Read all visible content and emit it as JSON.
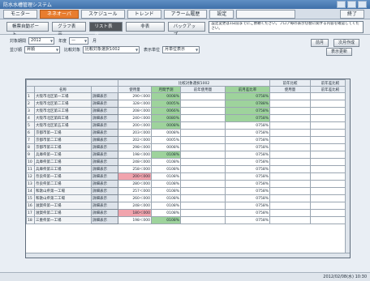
{
  "title": "防水水槽管理システム",
  "menu": {
    "items": [
      "モニター",
      "ネネオーバ",
      "スケジュール",
      "トレンド",
      "アラーム履歴",
      "設定",
      "",
      "終了"
    ],
    "active_index": 1
  },
  "toolbar": {
    "buttons": [
      "帳票自動ポート",
      "グラフ表示",
      "リスト表示",
      "非表",
      "バックアップ"
    ]
  },
  "notice": "設定変更は1日前までにご依頼ください。フロア毎の表示切替に関する内容を確認してください。",
  "filters": {
    "period_label": "対象期間",
    "period_value": "2012",
    "year_label": "年度",
    "month_value": "—",
    "month_suffix": "月",
    "unit_label": "並び順",
    "unit_value": "昇順",
    "display_label": "比較対象",
    "display_value": "比較対象選択1002",
    "target_label": "表示単位",
    "target_value": "月単位表示"
  },
  "right_buttons": [
    "前月",
    "次月作成",
    "表示更新"
  ],
  "table": {
    "group_headers": [
      "比較対象選択1002",
      "前年比較",
      "前年差比較"
    ],
    "columns": [
      "名称",
      "",
      "使用量",
      "月間予測",
      "前年使用量",
      "前月差比率",
      "使用量",
      "前年差比較"
    ],
    "rows": [
      {
        "no": "1",
        "name": "大阪市北区第一工場",
        "detail": "詳細表示",
        "a": "290＜000",
        "b": "0008%",
        "d": "0758%",
        "ca": true,
        "cd": true
      },
      {
        "no": "2",
        "name": "大阪市北区第二工場",
        "detail": "詳細表示",
        "a": "328＜000",
        "b": "0005%",
        "d": "0788%",
        "ca": true,
        "cd": true
      },
      {
        "no": "3",
        "name": "大阪市北区第三工場",
        "detail": "詳細表示",
        "a": "208＜000",
        "b": "0066%",
        "d": "0758%",
        "ca": true,
        "cd": true
      },
      {
        "no": "4",
        "name": "大阪市北区第四工場",
        "detail": "詳細表示",
        "a": "240＜000",
        "b": "0080%",
        "d": "0758%",
        "ca": true,
        "cd": true
      },
      {
        "no": "5",
        "name": "大阪市北区第五工場",
        "detail": "詳細表示",
        "a": "200＜000",
        "b": "0008%",
        "d": "0758%",
        "ca": true,
        "cd": false
      },
      {
        "no": "6",
        "name": "京都市第一工場",
        "detail": "詳細表示",
        "a": "203＜000",
        "b": "0008%",
        "d": "0758%",
        "ca": false,
        "cd": false
      },
      {
        "no": "7",
        "name": "京都市第二工場",
        "detail": "詳細表示",
        "a": "202＜000",
        "b": "0005%",
        "d": "0758%",
        "ca": false,
        "cd": false
      },
      {
        "no": "8",
        "name": "京都市第三工場",
        "detail": "詳細表示",
        "a": "298＜000",
        "b": "0008%",
        "d": "0758%",
        "ca": false,
        "cd": false
      },
      {
        "no": "9",
        "name": "兵庫県第一工場",
        "detail": "詳細表示",
        "a": "198＜000",
        "b": "0108%",
        "d": "0758%",
        "ca": true,
        "cd": false
      },
      {
        "no": "10",
        "name": "兵庫県第二工場",
        "detail": "詳細表示",
        "a": "248＜000",
        "b": "0108%",
        "d": "0758%",
        "ca": false,
        "cd": false
      },
      {
        "no": "11",
        "name": "兵庫県第三工場",
        "detail": "詳細表示",
        "a": "258＜000",
        "b": "0108%",
        "d": "0758%",
        "ca": false,
        "cd": false
      },
      {
        "no": "12",
        "name": "奈良県第一工場",
        "detail": "詳細表示",
        "a": "200＜000",
        "b": "0108%",
        "d": "0758%",
        "ca": false,
        "cd": false,
        "pink": true
      },
      {
        "no": "13",
        "name": "奈良県第二工場",
        "detail": "詳細表示",
        "a": "280＜000",
        "b": "0108%",
        "d": "0758%",
        "ca": false,
        "cd": false
      },
      {
        "no": "14",
        "name": "和歌山県第一工場",
        "detail": "詳細表示",
        "a": "257＜000",
        "b": "0108%",
        "d": "0758%",
        "ca": false,
        "cd": false
      },
      {
        "no": "15",
        "name": "和歌山県第二工場",
        "detail": "詳細表示",
        "a": "260＜000",
        "b": "0108%",
        "d": "0758%",
        "ca": false,
        "cd": false
      },
      {
        "no": "16",
        "name": "滋賀県第一工場",
        "detail": "詳細表示",
        "a": "248＜000",
        "b": "0108%",
        "d": "0758%",
        "ca": false,
        "cd": false
      },
      {
        "no": "17",
        "name": "滋賀県第二工場",
        "detail": "詳細表示",
        "a": "180＜000",
        "b": "0108%",
        "d": "0758%",
        "ca": false,
        "cd": false,
        "pink": true
      },
      {
        "no": "18",
        "name": "三重県第一工場",
        "detail": "詳細表示",
        "a": "198＜000",
        "b": "0108%",
        "d": "0758%",
        "ca": true,
        "cd": false
      }
    ]
  },
  "status_time": "2012/02/08(水) 10:30"
}
